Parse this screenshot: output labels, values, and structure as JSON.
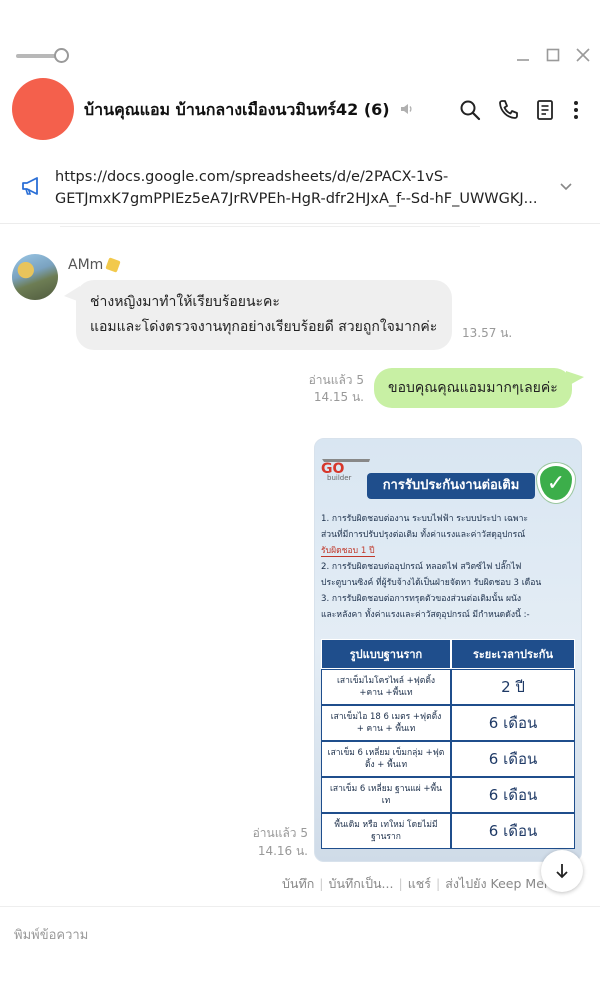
{
  "window": {
    "controls": [
      "minimize",
      "maximize",
      "close"
    ]
  },
  "header": {
    "title": "บ้านคุณแอม บ้านกลางเมืองนวมินทร์42 (6)",
    "avatar_color": "#f4604c",
    "icons": [
      "mute-icon",
      "search-icon",
      "phone-icon",
      "notes-icon",
      "more-icon"
    ]
  },
  "announcement": {
    "line1": "https://docs.google.com/spreadsheets/d/e/2PACX-1vS-",
    "line2": "GETJmxK7gmPPIEz5eA7JrRVPEh-HgR-dfr2HJxA_f--Sd-hF_UWWGKJ..."
  },
  "messages": {
    "incoming": {
      "sender": "AMm",
      "line1": "ช่างหญิงมาทำให้เรียบร้อยนะคะ",
      "line2": "แอมและโด่งตรวจงานทุกอย่างเรียบร้อยดี สวยถูกใจมากค่ะ",
      "time": "13.57 น."
    },
    "outgoing_text": {
      "read": "อ่านแล้ว 5",
      "time": "14.15 น.",
      "text": "ขอบคุณคุณแอมมากๆเลยค่ะ"
    },
    "outgoing_image": {
      "read": "อ่านแล้ว 5",
      "time": "14.16 น.",
      "logo": "GO",
      "logo_sub": "builder",
      "title": "การรับประกันงานต่อเติม",
      "body": [
        "1. การรับผิดชอบต่องาน ระบบไฟฟ้า ระบบประปา เฉพาะ",
        "ส่วนที่มีการปรับปรุงต่อเติม ทั้งค่าแรงและค่าวัสดุอุปกรณ์",
        "รับผิดชอบ 1 ปี",
        "2. การรับผิดชอบต่ออุปกรณ์ หลอดไฟ สวิตซ์ไฟ ปลั๊กไฟ",
        "ประตูบานซิงค์ ที่ผู้รับจ้างได้เป็นฝ่ายจัดหา รับผิดชอบ 3 เดือน",
        "3. การรับผิดชอบต่อการทรุดตัวของส่วนต่อเติมนั้น ผนัง",
        "และหลังคา ทั้งค่าแรงและค่าวัสดุอุปกรณ์ มีกำหนดดังนี้ :-"
      ],
      "table": {
        "headers": [
          "รูปแบบฐานราก",
          "ระยะเวลาประกัน"
        ],
        "rows": [
          {
            "type": "เสาเข็มไมโครไพล์ +ฟุตติ้ง +คาน +พื้นเท",
            "period": "2 ปี"
          },
          {
            "type": "เสาเข็มไอ 18 6 เมตร +ฟุตติ้ง + คาน + พื้นเท",
            "period": "6 เดือน"
          },
          {
            "type": "เสาเข็ม 6 เหลี่ยม เข็มกลุ่ม +ฟุตติ้ง + พื้นเท",
            "period": "6 เดือน"
          },
          {
            "type": "เสาเข็ม 6 เหลี่ยม ฐานแผ่ +พื้นเท",
            "period": "6 เดือน"
          },
          {
            "type": "พื้นเดิม หรือ เทใหม่ โดยไม่มีฐานราก",
            "period": "6 เดือน"
          }
        ]
      }
    },
    "actions": [
      "บันทึก",
      "บันทึกเป็น...",
      "แชร์",
      "ส่งไปยัง Keep Memo"
    ]
  },
  "input": {
    "placeholder": "พิมพ์ข้อความ"
  },
  "colors": {
    "incoming_bubble": "#efefef",
    "outgoing_bubble": "#c8f0a4",
    "accent_blue": "#1f4e8c"
  }
}
